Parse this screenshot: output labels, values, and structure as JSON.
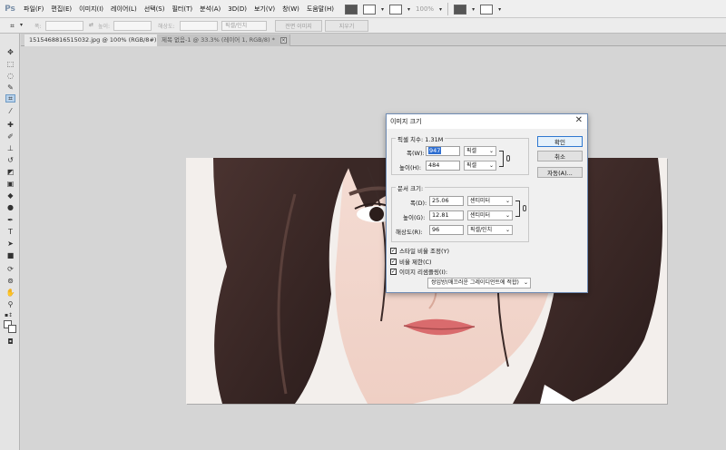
{
  "app": {
    "logo": "Ps"
  },
  "menu": [
    "파일(F)",
    "편집(E)",
    "이미지(I)",
    "레이어(L)",
    "선택(S)",
    "필터(T)",
    "분석(A)",
    "3D(D)",
    "보기(V)",
    "창(W)",
    "도움말(H)"
  ],
  "menu_right": {
    "zoom": "100%"
  },
  "options_bar": {
    "width_label": "폭:",
    "height_label": "높이:",
    "resolution_label": "해상도:",
    "resolution_unit": "픽셀/인치",
    "front_image_button": "전면 이미지",
    "clear_button": "지우기"
  },
  "tabs": [
    {
      "label": "1515468816515032.jpg @ 100% (RGB/8#)"
    },
    {
      "label": "제목 없음-1 @ 33.3% (레이어 1, RGB/8) *"
    }
  ],
  "tab_close_glyph": "×",
  "dialog": {
    "title": "이미지 크기",
    "close_glyph": "✕",
    "pixel_dimensions": {
      "legend": "픽셀 치수: 1.31M",
      "width_label": "폭(W):",
      "width_value": "947",
      "width_unit": "픽셀",
      "height_label": "높이(H):",
      "height_value": "484",
      "height_unit": "픽셀"
    },
    "document_size": {
      "legend": "문서 크기:",
      "width_label": "폭(D):",
      "width_value": "25.06",
      "width_unit": "센티미터",
      "height_label": "높이(G):",
      "height_value": "12.81",
      "height_unit": "센티미터",
      "resolution_label": "해상도(R):",
      "resolution_value": "96",
      "resolution_unit": "픽셀/인치"
    },
    "buttons": {
      "ok": "확인",
      "cancel": "취소",
      "auto": "자동(A)..."
    },
    "checkboxes": [
      {
        "label": "스타일 비율 조정(Y)",
        "checked": true
      },
      {
        "label": "비율 제한(C)",
        "checked": true
      },
      {
        "label": "이미지 리샘플링(I):",
        "checked": true
      }
    ],
    "check_glyph": "✓",
    "resample_method": "쌍입방(매끄러운 그레이디언트에 적합)"
  },
  "colors": {
    "menubar_bg": "#efefef",
    "toolbox_bg": "#e4e4e4",
    "workspace_bg": "#d5d5d5",
    "dialog_border": "#6f8cb4",
    "selection_blue": "#2f6fd1"
  }
}
